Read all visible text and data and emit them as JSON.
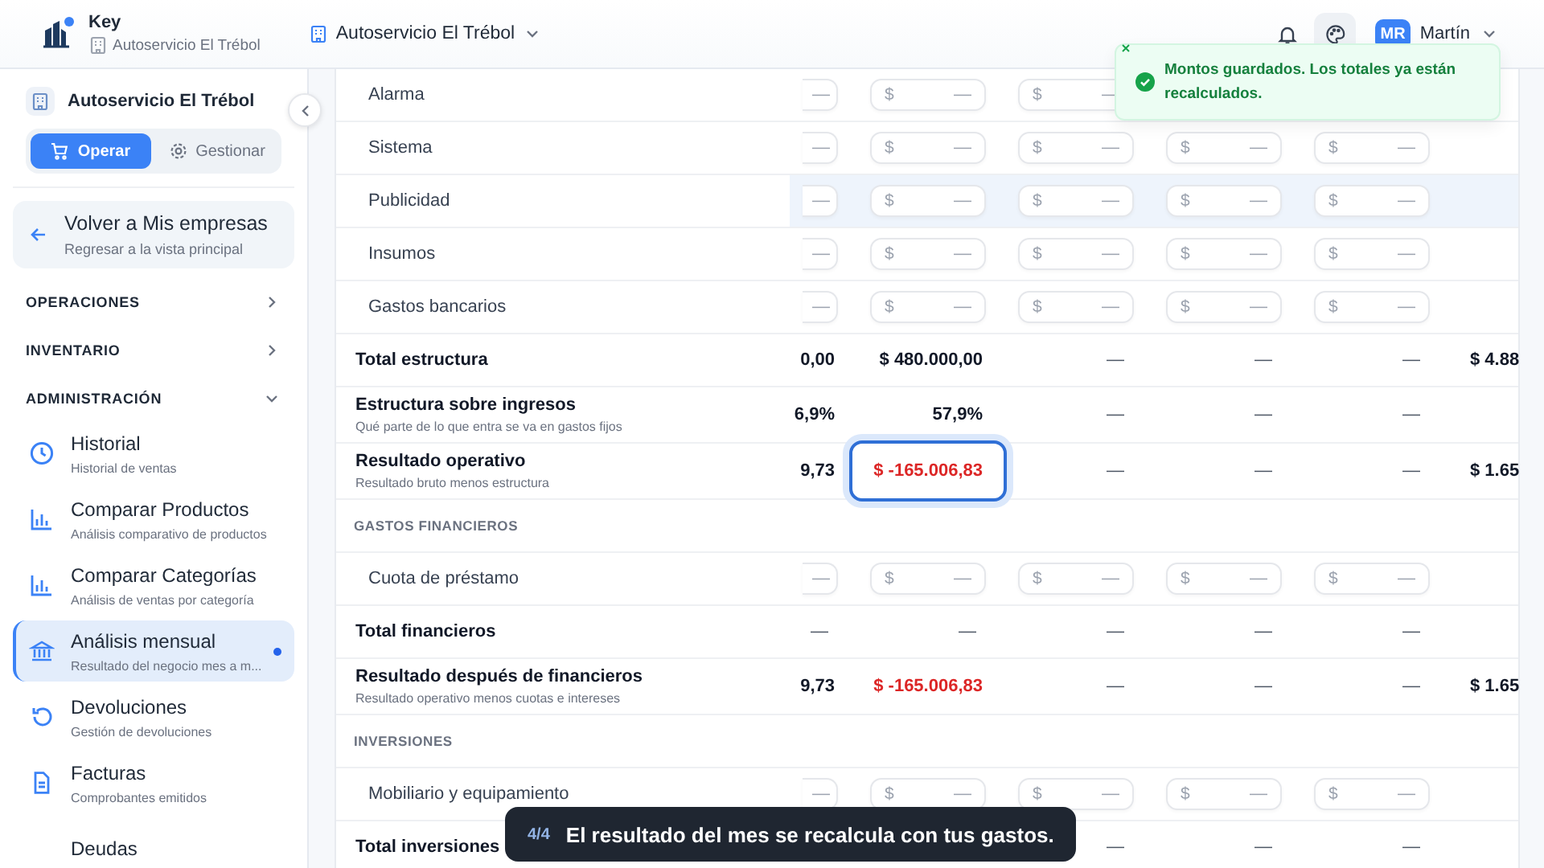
{
  "header": {
    "app_name": "Key",
    "business": "Autoservicio El Trébol",
    "company_selector": "Autoservicio El Trébol",
    "user_initials": "MR",
    "user_name": "Martín"
  },
  "sidebar": {
    "company": "Autoservicio El Trébol",
    "modes": [
      {
        "label": "Operar",
        "kind": "cart",
        "selected": true
      },
      {
        "label": "Gestionar",
        "kind": "gear",
        "selected": false
      }
    ],
    "back": {
      "title": "Volver a Mis empresas",
      "subtitle": "Regresar a la vista principal"
    },
    "sections": [
      {
        "title": "OPERACIONES",
        "expanded": false
      },
      {
        "title": "INVENTARIO",
        "expanded": false
      },
      {
        "title": "ADMINISTRACIÓN",
        "expanded": true,
        "items": [
          {
            "title": "Historial",
            "subtitle": "Historial de ventas",
            "kind": "clock",
            "selected": false
          },
          {
            "title": "Comparar Productos",
            "subtitle": "Análisis comparativo de productos",
            "kind": "chart",
            "selected": false
          },
          {
            "title": "Comparar Categorías",
            "subtitle": "Análisis de ventas por categoría",
            "kind": "chart",
            "selected": false
          },
          {
            "title": "Análisis mensual",
            "subtitle": "Resultado del negocio mes a m...",
            "kind": "bank",
            "selected": true
          },
          {
            "title": "Devoluciones",
            "subtitle": "Gestión de devoluciones",
            "kind": "undo",
            "selected": false
          },
          {
            "title": "Facturas",
            "subtitle": "Comprobantes emitidos",
            "kind": "document",
            "selected": false
          },
          {
            "title": "Deudas",
            "kind": "none",
            "selected": false
          }
        ]
      }
    ]
  },
  "table": {
    "rows": [
      {
        "kind": "input",
        "label": "Alarma",
        "hovered": false,
        "cells": [
          {
            "value": "—"
          },
          {
            "prefix": "$",
            "value": "—"
          },
          {
            "prefix": "$",
            "value": "—"
          }
        ]
      },
      {
        "kind": "input",
        "label": "Sistema",
        "hovered": false,
        "cells": [
          {
            "value": "—"
          },
          {
            "prefix": "$",
            "value": "—"
          },
          {
            "prefix": "$",
            "value": "—"
          },
          {
            "prefix": "$",
            "value": "—"
          },
          {
            "prefix": "$",
            "value": "—"
          }
        ]
      },
      {
        "kind": "input",
        "label": "Publicidad",
        "hovered": true,
        "cells": [
          {
            "value": "—"
          },
          {
            "prefix": "$",
            "value": "—"
          },
          {
            "prefix": "$",
            "value": "—"
          },
          {
            "prefix": "$",
            "value": "—"
          },
          {
            "prefix": "$",
            "value": "—"
          }
        ]
      },
      {
        "kind": "input",
        "label": "Insumos",
        "hovered": false,
        "cells": [
          {
            "value": "—"
          },
          {
            "prefix": "$",
            "value": "—"
          },
          {
            "prefix": "$",
            "value": "—"
          },
          {
            "prefix": "$",
            "value": "—"
          },
          {
            "prefix": "$",
            "value": "—"
          }
        ]
      },
      {
        "kind": "input",
        "label": "Gastos bancarios",
        "hovered": false,
        "cells": [
          {
            "value": "—"
          },
          {
            "prefix": "$",
            "value": "—"
          },
          {
            "prefix": "$",
            "value": "—"
          },
          {
            "prefix": "$",
            "value": "—"
          },
          {
            "prefix": "$",
            "value": "—"
          }
        ]
      },
      {
        "kind": "total",
        "label": "Total estructura",
        "values": [
          "0,00",
          "$ 480.000,00",
          "—",
          "—",
          "—"
        ],
        "total": "$ 4.88"
      },
      {
        "kind": "metric",
        "label": "Estructura sobre ingresos",
        "subtitle": "Qué parte de lo que entra se va en gastos fijos",
        "values": [
          "6,9%",
          "57,9%",
          "—",
          "—",
          "—"
        ]
      },
      {
        "kind": "metric",
        "label": "Resultado operativo",
        "subtitle": "Resultado bruto menos estructura",
        "values": [
          "9,73",
          {
            "text": "$ -165.006,83",
            "negative": true,
            "highlighted": true
          },
          "—",
          "—",
          "—"
        ],
        "total": "$ 1.65"
      },
      {
        "kind": "section",
        "label": "GASTOS FINANCIEROS"
      },
      {
        "kind": "input",
        "label": "Cuota de préstamo",
        "hovered": false,
        "cells": [
          {
            "value": "—"
          },
          {
            "prefix": "$",
            "value": "—"
          },
          {
            "prefix": "$",
            "value": "—"
          },
          {
            "prefix": "$",
            "value": "—"
          },
          {
            "prefix": "$",
            "value": "—"
          }
        ]
      },
      {
        "kind": "total",
        "label": "Total financieros",
        "values": [
          "—",
          "—",
          "—",
          "—",
          "—"
        ]
      },
      {
        "kind": "metric",
        "label": "Resultado después de financieros",
        "subtitle": "Resultado operativo menos cuotas e intereses",
        "values": [
          "9,73",
          {
            "text": "$ -165.006,83",
            "negative": true,
            "highlighted": false
          },
          "—",
          "—",
          "—"
        ],
        "total": "$ 1.65"
      },
      {
        "kind": "section",
        "label": "INVERSIONES"
      },
      {
        "kind": "input",
        "label": "Mobiliario y equipamiento",
        "hovered": false,
        "cells": [
          {
            "value": "—"
          },
          {
            "prefix": "$",
            "value": "—"
          },
          {
            "prefix": "$",
            "value": "—"
          },
          {
            "prefix": "$",
            "value": "—"
          },
          {
            "prefix": "$",
            "value": "—"
          }
        ]
      },
      {
        "kind": "total",
        "label": "Total inversiones",
        "values": [
          {
            "covered": true
          },
          {
            "covered": true
          },
          "—",
          "—",
          "—"
        ]
      }
    ]
  },
  "toast": {
    "message": "Montos guardados. Los totales ya están recalculados."
  },
  "tour": {
    "step": "4/4",
    "text": "El resultado del mes se recalcula con tus gastos."
  }
}
